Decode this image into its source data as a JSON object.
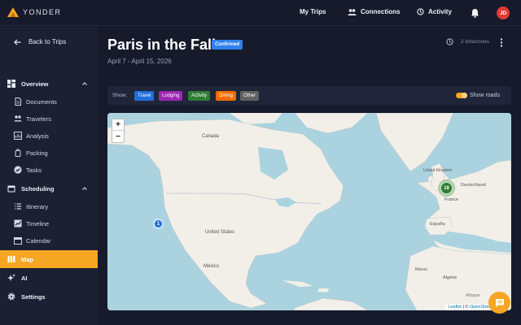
{
  "app": {
    "brand": "YONDER",
    "brand_color": "#f5a623"
  },
  "topnav": {
    "my_trips": "My Trips",
    "connections": "Connections",
    "activity": "Activity",
    "avatar_initials": "JD"
  },
  "sidebar": {
    "back_label": "Back to Trips",
    "overview": {
      "label": "Overview",
      "items": [
        {
          "label": "Documents",
          "icon": "document-icon"
        },
        {
          "label": "Travelers",
          "icon": "people-icon"
        },
        {
          "label": "Analysis",
          "icon": "chart-icon"
        },
        {
          "label": "Packing",
          "icon": "luggage-icon"
        },
        {
          "label": "Tasks",
          "icon": "check-circle-icon"
        }
      ]
    },
    "scheduling": {
      "label": "Scheduling",
      "items": [
        {
          "label": "Itinerary",
          "icon": "list-icon"
        },
        {
          "label": "Timeline",
          "icon": "timeline-icon"
        },
        {
          "label": "Calendar",
          "icon": "calendar-icon"
        }
      ]
    },
    "map": "Map",
    "ai": "AI",
    "settings": "Settings"
  },
  "trip": {
    "title": "Paris in the Fall",
    "status": "Confirmed",
    "dates": "April 7 - April 15, 2026",
    "timezones": "2 timezones"
  },
  "filters": {
    "show_label": "Show:",
    "chips": [
      {
        "label": "Travel",
        "color": "#1e6fd9"
      },
      {
        "label": "Lodging",
        "color": "#9c27b0"
      },
      {
        "label": "Activity",
        "color": "#2e7d32"
      },
      {
        "label": "Dining",
        "color": "#ef6c00"
      },
      {
        "label": "Other",
        "color": "#616161"
      }
    ],
    "show_roads": "Show roads",
    "show_roads_on": true
  },
  "map": {
    "zoom_in": "+",
    "zoom_out": "−",
    "labels": {
      "canada": "Canada",
      "united_states": "United States",
      "mexico": "México",
      "united_kingdom": "United Kingdom",
      "deutschland": "Deutschland",
      "france": "France",
      "espana": "España",
      "maroc": "Maroc",
      "algerie": "Algérie",
      "africa_label": "Afrique"
    },
    "markers": [
      {
        "count": "1",
        "color": "#1e6fd9"
      },
      {
        "count": "18",
        "color": "#2e7d32"
      }
    ],
    "attribution": {
      "leaflet": "Leaflet",
      "separator": "| ©",
      "osm": "OpenStreetMap",
      "suffix": "cor"
    }
  }
}
